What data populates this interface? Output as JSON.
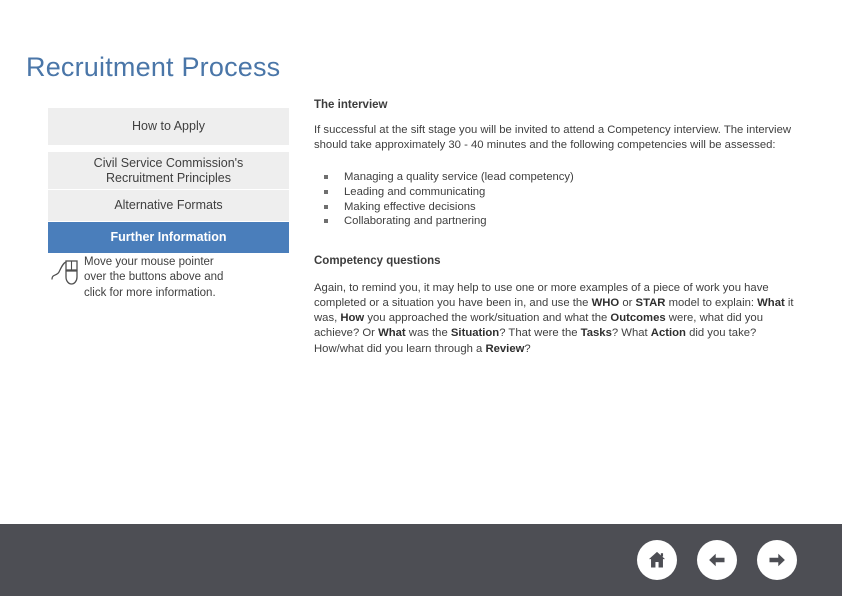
{
  "page": {
    "title": "Recruitment Process",
    "title_color": "#4a76a8",
    "background": "#ffffff"
  },
  "menu": {
    "active_color": "#4a7ebb",
    "inactive_color": "#eeeeee",
    "items": [
      {
        "label": "How to Apply",
        "active": false
      },
      {
        "line1": "Civil Service Commission's",
        "line2": "Recruitment Principles",
        "active": false
      },
      {
        "label": "Alternative Formats",
        "active": false
      },
      {
        "label": "Further Information",
        "active": true
      }
    ]
  },
  "hint": {
    "icon": "mouse-icon",
    "line1": "Move your mouse pointer",
    "line2": "over the buttons above and",
    "line3": "click for more information."
  },
  "content": {
    "interview_heading": "The interview",
    "interview_paragraph": "If successful at the sift stage you will be invited to attend a Competency interview. The interview should take approximately 30 - 40 minutes and the following competencies will be assessed:",
    "competencies": [
      "Managing a quality service (lead competency)",
      "Leading and communicating",
      "Making effective decisions",
      "Collaborating and partnering"
    ],
    "questions_heading": "Competency questions",
    "questions_paragraph_parts": [
      {
        "text": "Again, to remind you, it may help to use one or more examples of a piece of work you have completed or a situation you have been in, and use the ",
        "bold": false
      },
      {
        "text": "WHO",
        "bold": true
      },
      {
        "text": " or ",
        "bold": false
      },
      {
        "text": "STAR",
        "bold": true
      },
      {
        "text": " model to explain: ",
        "bold": false
      },
      {
        "text": "What",
        "bold": true
      },
      {
        "text": " it was, ",
        "bold": false
      },
      {
        "text": "How",
        "bold": true
      },
      {
        "text": " you approached the work/situation and what the ",
        "bold": false
      },
      {
        "text": "Outcomes",
        "bold": true
      },
      {
        "text": " were, what did you achieve? Or ",
        "bold": false
      },
      {
        "text": "What",
        "bold": true
      },
      {
        "text": " was the ",
        "bold": false
      },
      {
        "text": "Situation",
        "bold": true
      },
      {
        "text": "? That were the ",
        "bold": false
      },
      {
        "text": "Tasks",
        "bold": true
      },
      {
        "text": "? What ",
        "bold": false
      },
      {
        "text": "Action",
        "bold": true
      },
      {
        "text": " did you take? How/what did you learn through a ",
        "bold": false
      },
      {
        "text": "Review",
        "bold": true
      },
      {
        "text": "?",
        "bold": false
      }
    ]
  },
  "footer": {
    "background": "#4d4e54",
    "buttons": [
      {
        "name": "home-icon"
      },
      {
        "name": "arrow-left-icon"
      },
      {
        "name": "arrow-right-icon"
      }
    ]
  }
}
